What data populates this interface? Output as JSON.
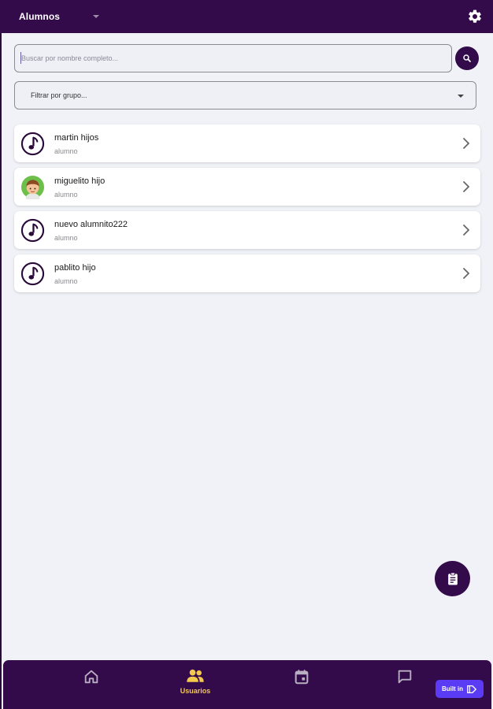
{
  "header": {
    "title": "Alumnos",
    "settings_icon": "gear-icon",
    "background": "#330a4a"
  },
  "search": {
    "value": "",
    "placeholder": "Buscar por nombre completo...",
    "button_icon": "search-icon"
  },
  "group_filter": {
    "placeholder": "Filtrar por grupo..."
  },
  "students": [
    {
      "name": "martin hijos",
      "role": "alumno",
      "avatar": "music-note-icon"
    },
    {
      "name": "miguelito hijo",
      "role": "alumno",
      "avatar": "boy-avatar"
    },
    {
      "name": "nuevo alumnito222",
      "role": "alumno",
      "avatar": "music-note-icon"
    },
    {
      "name": "pablito hijo",
      "role": "alumno",
      "avatar": "music-note-icon"
    }
  ],
  "fab": {
    "icon": "clipboard-icon"
  },
  "bottom_nav": {
    "items": [
      {
        "icon": "home-icon",
        "label": ""
      },
      {
        "icon": "users-icon",
        "label": "Usuarios",
        "active": true
      },
      {
        "icon": "calendar-icon",
        "label": ""
      },
      {
        "icon": "chat-icon",
        "label": ""
      }
    ],
    "active_color": "#f2c94c",
    "inactive_color": "#b8b0c2"
  },
  "built_in_badge": {
    "label": "Built in"
  }
}
